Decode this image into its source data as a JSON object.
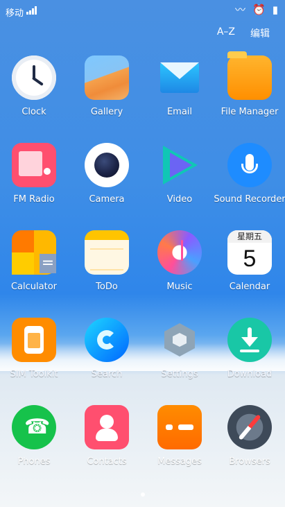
{
  "status_bar": {
    "carrier": "移动",
    "wifi_icon": "wifi-icon",
    "alarm_icon": "alarm-icon",
    "battery_icon": "battery-icon"
  },
  "top_actions": {
    "sort_label": "A–Z",
    "edit_label": "编辑"
  },
  "apps": [
    {
      "label": "Clock",
      "icon": "clock-icon"
    },
    {
      "label": "Gallery",
      "icon": "gallery-icon"
    },
    {
      "label": "Email",
      "icon": "email-icon"
    },
    {
      "label": "File Manager",
      "icon": "file-manager-icon"
    },
    {
      "label": "FM Radio",
      "icon": "fm-radio-icon"
    },
    {
      "label": "Camera",
      "icon": "camera-icon"
    },
    {
      "label": "Video",
      "icon": "video-icon"
    },
    {
      "label": "Sound Recorder",
      "icon": "sound-recorder-icon"
    },
    {
      "label": "Calculator",
      "icon": "calculator-icon"
    },
    {
      "label": "ToDo",
      "icon": "todo-icon"
    },
    {
      "label": "Music",
      "icon": "music-icon"
    },
    {
      "label": "Calendar",
      "icon": "calendar-icon",
      "calendar_header": "星期五",
      "calendar_day": "5"
    },
    {
      "label": "SIM Toolkit",
      "icon": "sim-toolkit-icon"
    },
    {
      "label": "Search",
      "icon": "search-icon"
    },
    {
      "label": "Settings",
      "icon": "settings-icon"
    },
    {
      "label": "Download",
      "icon": "download-icon"
    }
  ],
  "dock": [
    {
      "label": "Phones",
      "icon": "phone-icon"
    },
    {
      "label": "Contacts",
      "icon": "contacts-icon"
    },
    {
      "label": "Messages",
      "icon": "messages-icon"
    },
    {
      "label": "Browsers",
      "icon": "browsers-icon"
    }
  ]
}
